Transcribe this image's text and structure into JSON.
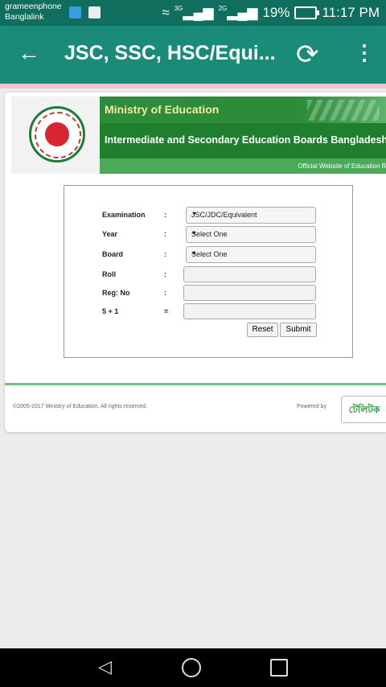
{
  "status_bar": {
    "carrier_1": "grameenphone",
    "carrier_2": "Banglalink",
    "net_1": "3G",
    "net_2": "2G",
    "battery": "19%",
    "time": "11:17 PM"
  },
  "app_bar": {
    "title": "JSC, SSC, HSC/Equi..."
  },
  "banner": {
    "ministry": "Ministry of Education",
    "boards": "Intermediate and Secondary Education Boards Bangladesh",
    "tagline": "Official Website of Education B"
  },
  "form": {
    "examination": {
      "label": "Examination",
      "colon": ":",
      "value": "JSC/JDC/Equivalent"
    },
    "year": {
      "label": "Year",
      "colon": ":",
      "value": "Select One"
    },
    "board": {
      "label": "Board",
      "colon": ":",
      "value": "Select One"
    },
    "roll": {
      "label": "Roll",
      "colon": ":"
    },
    "reg": {
      "label": "Reg: No",
      "colon": ":"
    },
    "captcha": {
      "label": "5 + 1",
      "colon": "="
    },
    "reset_label": "Reset",
    "submit_label": "Submit"
  },
  "footer": {
    "copyright": "©2005-2017 Ministry of Education, All rights reserved.",
    "powered_by": "Powered by",
    "brand": "টেলিটক"
  },
  "icons": {
    "back": "arrow-left-icon",
    "refresh": "refresh-icon",
    "more": "more-vertical-icon"
  }
}
